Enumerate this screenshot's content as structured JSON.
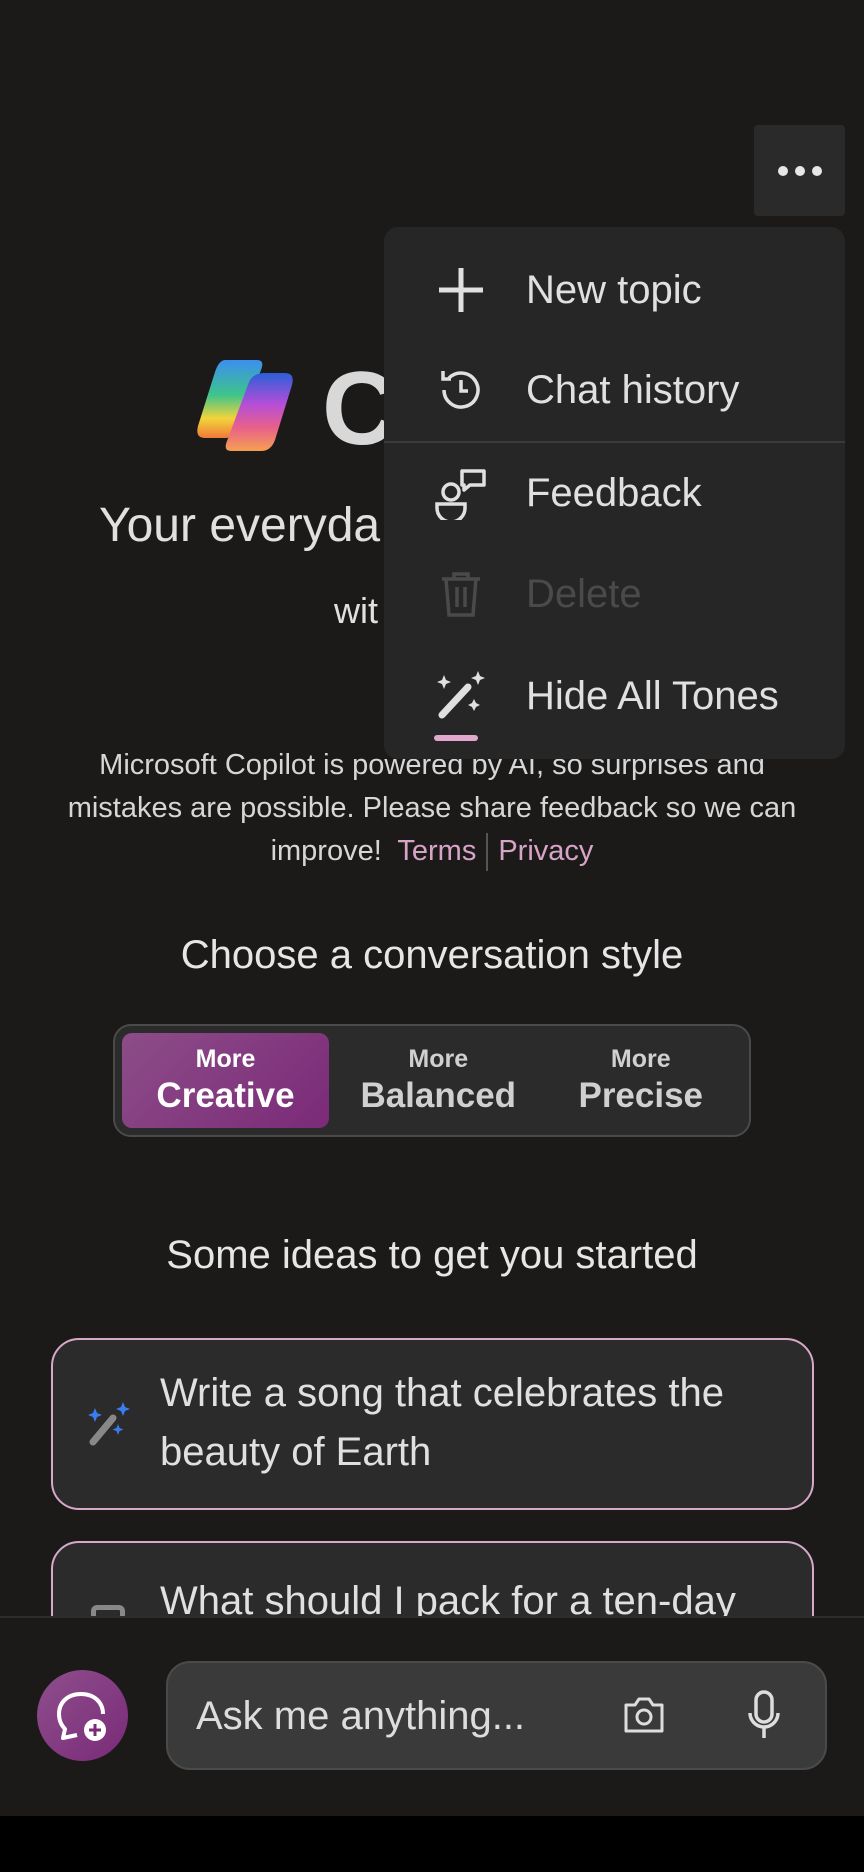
{
  "header": {
    "more_icon": "more-horizontal-icon"
  },
  "hero": {
    "title": "C",
    "tagline": "Your everyda",
    "subtitle": "wit"
  },
  "disclaimer": {
    "text": "Microsoft Copilot is powered by AI, so surprises and mistakes are possible. Please share feedback so we can improve!",
    "terms": "Terms",
    "privacy": "Privacy"
  },
  "style": {
    "heading": "Choose a conversation style",
    "options": [
      {
        "small": "More",
        "big": "Creative",
        "selected": true
      },
      {
        "small": "More",
        "big": "Balanced",
        "selected": false
      },
      {
        "small": "More",
        "big": "Precise",
        "selected": false
      }
    ]
  },
  "ideas": {
    "heading": "Some ideas to get you started",
    "cards": [
      {
        "text": "Write a song that celebrates the beauty of Earth",
        "icon": "magic-wand-icon"
      },
      {
        "text": "What should I pack for a ten-day",
        "icon": "luggage-icon"
      }
    ]
  },
  "input": {
    "placeholder": "Ask me anything..."
  },
  "menu": {
    "items": [
      {
        "label": "New topic",
        "icon": "plus-icon"
      },
      {
        "label": "Chat history",
        "icon": "history-icon"
      },
      {
        "label": "Feedback",
        "icon": "feedback-icon"
      },
      {
        "label": "Delete",
        "icon": "trash-icon",
        "disabled": true
      },
      {
        "label": "Hide All Tones",
        "icon": "magic-wand-icon"
      }
    ]
  },
  "colors": {
    "accent": "#7b2a78",
    "link": "#d7a4c8",
    "card_border": "#d6a9c8",
    "background": "#1b1a19"
  }
}
